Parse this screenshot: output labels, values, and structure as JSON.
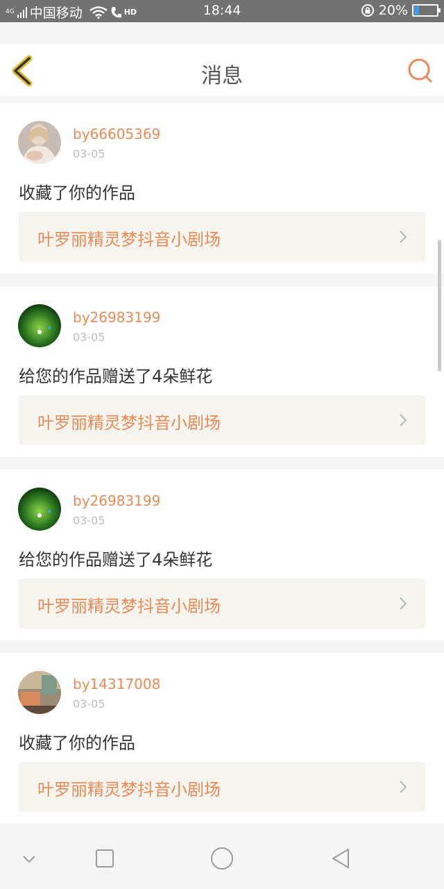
{
  "status_bar": {
    "network_badge": "4G",
    "carrier": "中国移动",
    "hd_badge": "HD",
    "time": "18:44",
    "battery": "20%",
    "battery_level": 0.2
  },
  "header": {
    "title": "消息"
  },
  "messages": [
    {
      "username": "by66605369",
      "date": "03-05",
      "text": "收藏了你的作品",
      "work_title": "叶罗丽精灵梦抖音小剧场"
    },
    {
      "username": "by26983199",
      "date": "03-05",
      "text": "给您的作品赠送了4朵鲜花",
      "work_title": "叶罗丽精灵梦抖音小剧场"
    },
    {
      "username": "by26983199",
      "date": "03-05",
      "text": "给您的作品赠送了4朵鲜花",
      "work_title": "叶罗丽精灵梦抖音小剧场"
    },
    {
      "username": "by14317008",
      "date": "03-05",
      "text": "收藏了你的作品",
      "work_title": "叶罗丽精灵梦抖音小剧场"
    }
  ],
  "colors": {
    "accent": "#eb8a55",
    "status_bar": "#727272",
    "back_icon": "#e0b938"
  },
  "icons": {
    "back": "chevron-left-icon",
    "search": "search-icon",
    "row_chevron": "chevron-right-icon",
    "nav_down": "chevron-down-icon",
    "nav_recent": "square-icon",
    "nav_home": "circle-icon",
    "nav_back": "triangle-back-icon"
  }
}
